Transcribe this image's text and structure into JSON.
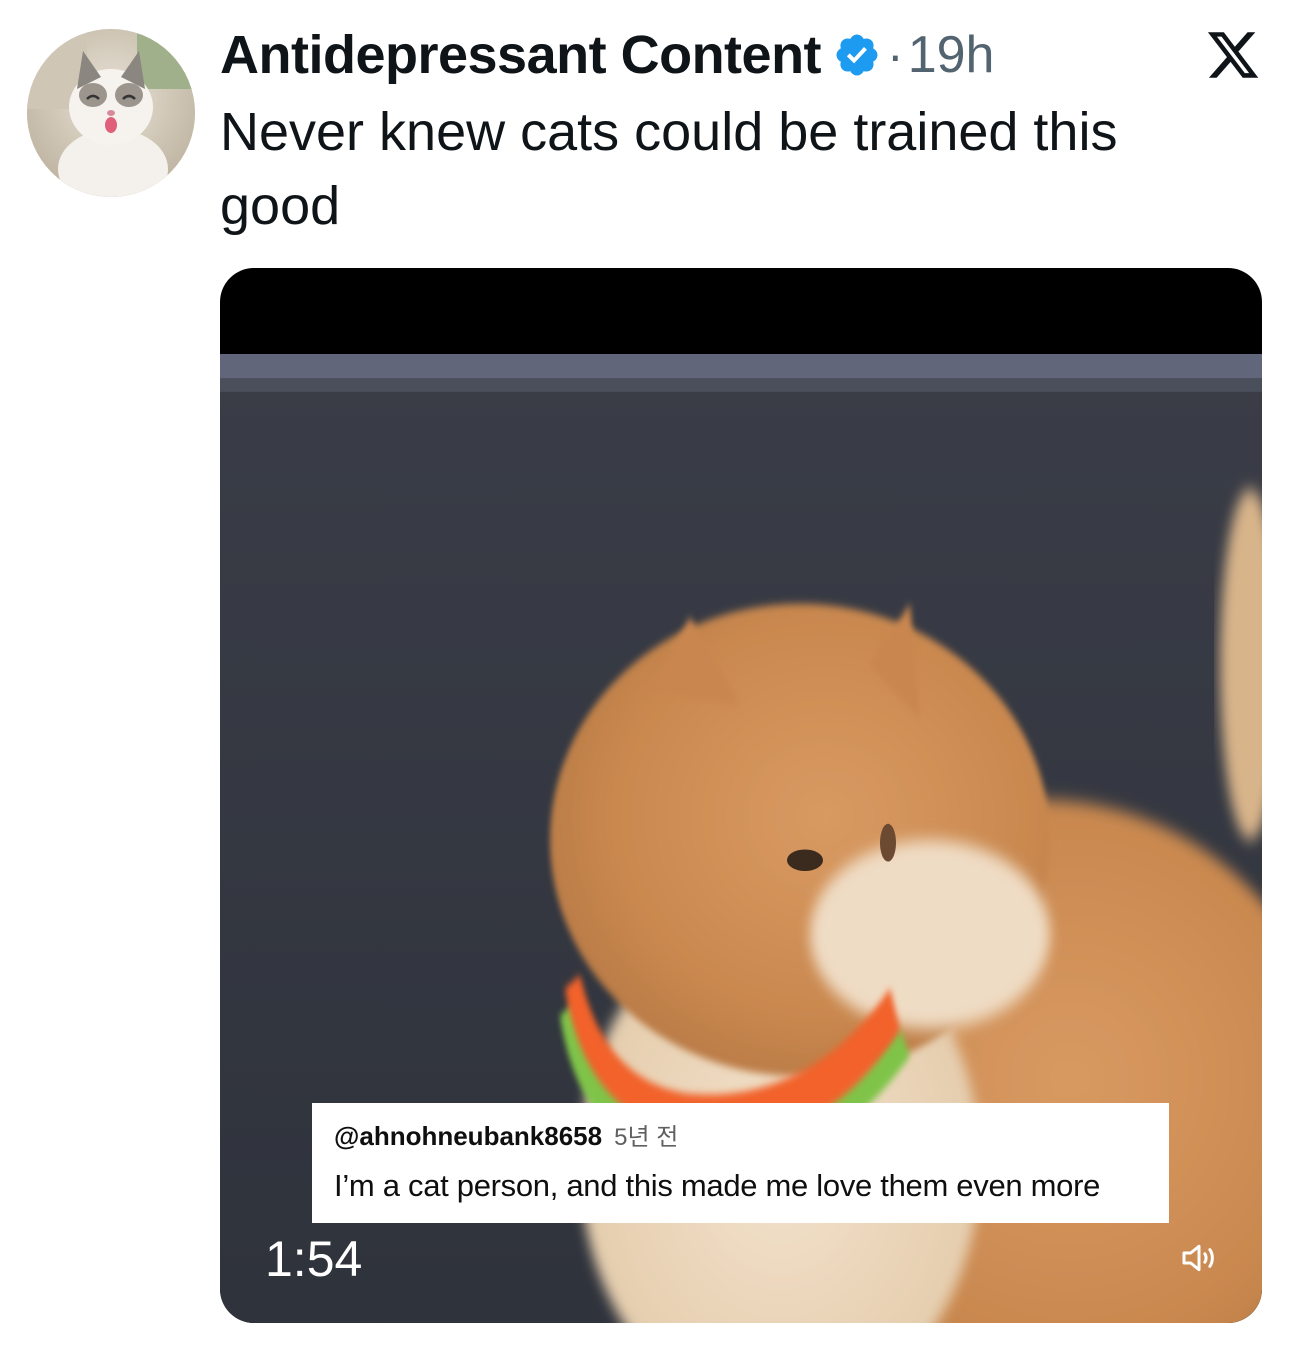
{
  "author": {
    "display_name": "Antidepressant Content",
    "verified": true,
    "separator": "·",
    "timestamp": "19h"
  },
  "tweet": {
    "text": "Never knew cats could be trained this good"
  },
  "media": {
    "type": "video",
    "duration": "1:54",
    "overlay_comment": {
      "username": "@ahnohneubank8658",
      "age": "5년 전",
      "text": "I’m a cat person, and this made me love them even more"
    }
  },
  "icons": {
    "verified": "verified-badge-icon",
    "brand": "x-logo-icon",
    "volume": "speaker-volume-icon"
  },
  "colors": {
    "verified_blue": "#1d9bf0",
    "secondary_text": "#536471",
    "primary_text": "#0f1419"
  }
}
